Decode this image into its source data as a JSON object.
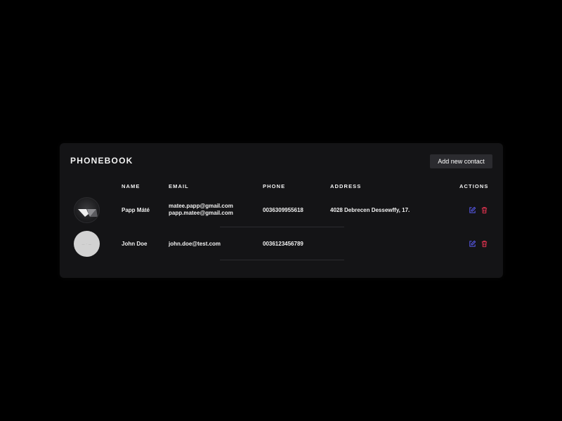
{
  "phonebook": {
    "title": "PHONEBOOK",
    "add_button_label": "Add new contact",
    "columns": {
      "name": "NAME",
      "email": "EMAIL",
      "phone": "PHONE",
      "address": "ADDRESS",
      "actions": "ACTIONS"
    },
    "contacts": [
      {
        "name": "Papp Máté",
        "emails": [
          "matee.papp@gmail.com",
          "papp.matee@gmail.com"
        ],
        "phone": "0036309955618",
        "address": "4028 Debrecen Dessewffy, 17.",
        "avatar": "logo"
      },
      {
        "name": "John Doe",
        "emails": [
          "john.doe@test.com"
        ],
        "phone": "0036123456789",
        "address": "",
        "avatar": "placeholder"
      }
    ]
  },
  "colors": {
    "background": "#000000",
    "card": "#141416",
    "button": "#2b2b2f",
    "edit_icon": "#5a5cf2",
    "delete_icon": "#e0334f"
  }
}
